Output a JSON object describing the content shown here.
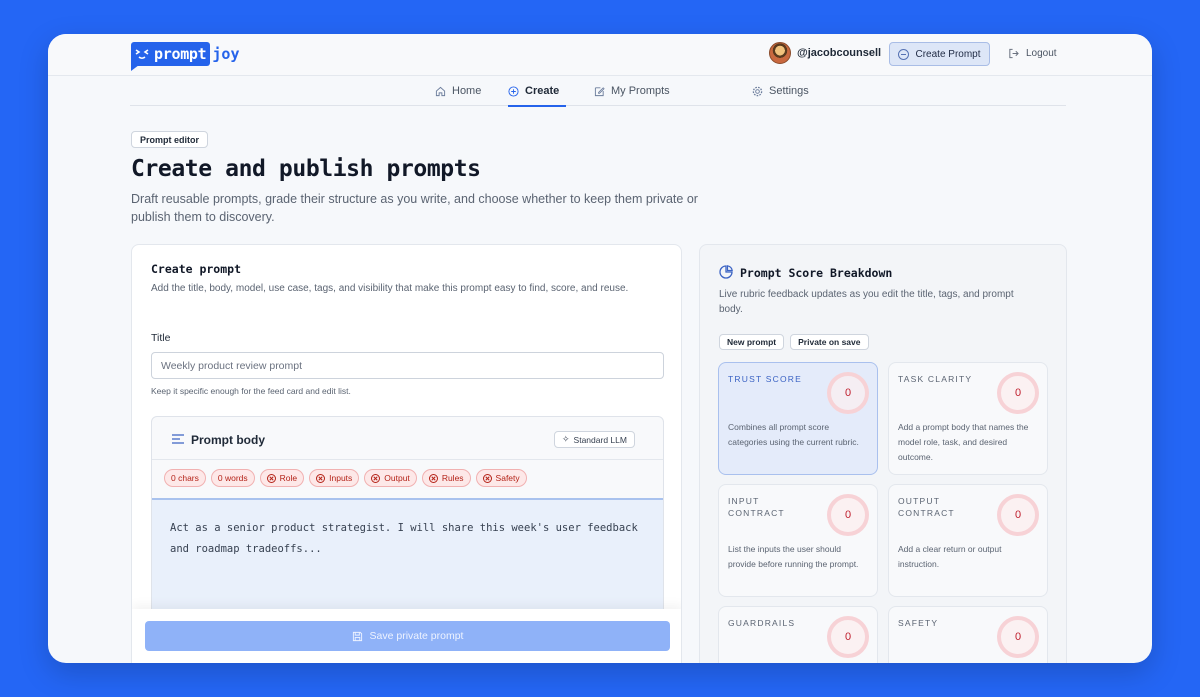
{
  "header": {
    "logo_part1": "prompt",
    "logo_part2": "joy",
    "username": "@jacobcounsell",
    "create_label": "Create Prompt",
    "logout_label": "Logout"
  },
  "nav": {
    "items": [
      {
        "label": "Home",
        "icon": "home-icon"
      },
      {
        "label": "Create",
        "icon": "plus-circle-icon"
      },
      {
        "label": "My Prompts",
        "icon": "edit-icon"
      },
      {
        "label": "Settings",
        "icon": "gear-icon"
      }
    ],
    "active": "Create"
  },
  "page": {
    "chip": "Prompt editor",
    "title": "Create and publish prompts",
    "subtitle": "Draft reusable prompts, grade their structure as you write, and choose whether to keep them private or publish them to discovery."
  },
  "form": {
    "card_title": "Create prompt",
    "card_subtitle": "Add the title, body, model, use case, tags, and visibility that make this prompt easy to find, score, and reuse.",
    "title_label": "Title",
    "title_placeholder": "Weekly product review prompt",
    "title_hint": "Keep it specific enough for the feed card and edit list.",
    "body_label": "Prompt body",
    "model_chip": "Standard LLM",
    "counters": [
      "0 chars",
      "0 words"
    ],
    "checks": [
      "Role",
      "Inputs",
      "Output",
      "Rules",
      "Safety"
    ],
    "body_placeholder_1": "Act as a senior product strategist. I will share this week's user feedback",
    "body_placeholder_2": "and roadmap tradeoffs...",
    "save_label": "Save private prompt"
  },
  "score_panel": {
    "title": "Prompt Score Breakdown",
    "subtitle": "Live rubric feedback updates as you edit the title, tags, and prompt body.",
    "chips": [
      "New prompt",
      "Private on save"
    ],
    "cards": [
      {
        "name": "TRUST SCORE",
        "value": "0",
        "desc": "Combines all prompt score categories using the current rubric."
      },
      {
        "name": "TASK CLARITY",
        "value": "0",
        "desc": "Add a prompt body that names the model role, task, and desired outcome."
      },
      {
        "name": "INPUT CONTRACT",
        "value": "0",
        "desc": "List the inputs the user should provide before running the prompt."
      },
      {
        "name": "OUTPUT CONTRACT",
        "value": "0",
        "desc": "Add a clear return or output instruction."
      },
      {
        "name": "GUARDRAILS",
        "value": "0",
        "desc": ""
      },
      {
        "name": "SAFETY",
        "value": "0",
        "desc": ""
      }
    ]
  },
  "colors": {
    "accent": "#2563eb",
    "background": "#2466f5",
    "danger": "#c0202f"
  }
}
